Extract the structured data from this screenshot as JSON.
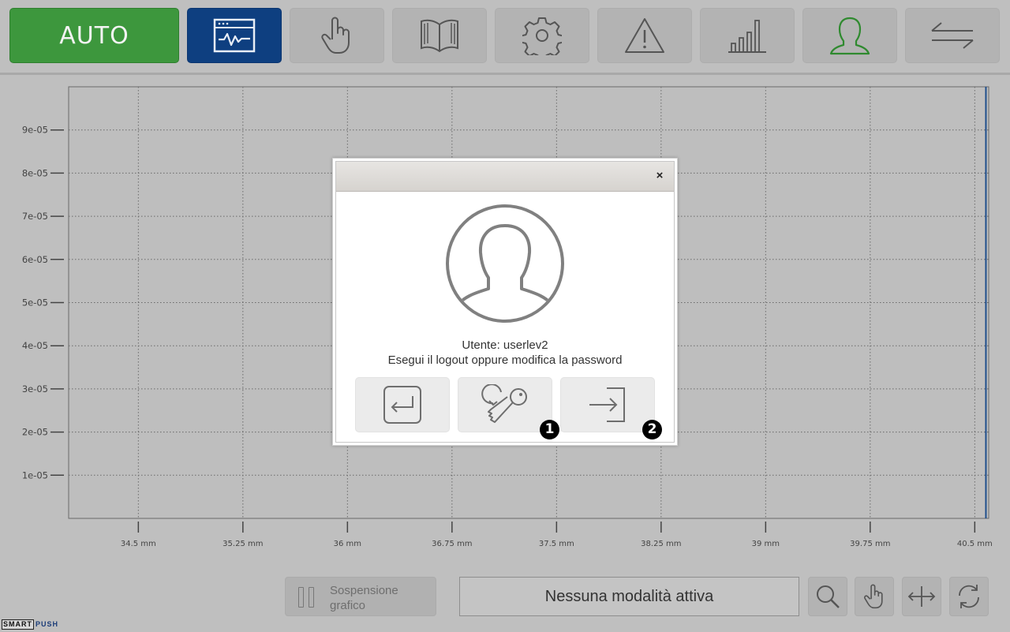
{
  "toolbar": {
    "auto_label": "AUTO",
    "accent_green": "#3d973d",
    "accent_blue": "#0e3f80",
    "items": [
      {
        "icon": "graph-window-icon",
        "active": true
      },
      {
        "icon": "hand-pointer-icon"
      },
      {
        "icon": "book-icon"
      },
      {
        "icon": "gear-icon"
      },
      {
        "icon": "warning-icon"
      },
      {
        "icon": "bar-chart-icon"
      },
      {
        "icon": "user-icon",
        "highlighted": true
      },
      {
        "icon": "swap-arrows-icon"
      }
    ]
  },
  "chart_data": {
    "type": "line",
    "x_tick_labels": [
      "34.5 mm",
      "35.25 mm",
      "36 mm",
      "36.75 mm",
      "37.5 mm",
      "38.25 mm",
      "39 mm",
      "39.75 mm",
      "40.5 mm"
    ],
    "x_ticks": [
      34.5,
      35.25,
      36,
      36.75,
      37.5,
      38.25,
      39,
      39.75,
      40.5
    ],
    "y_tick_labels": [
      "9e-05",
      "8e-05",
      "7e-05",
      "6e-05",
      "5e-05",
      "4e-05",
      "3e-05",
      "2e-05",
      "1e-05"
    ],
    "y_ticks": [
      9e-05,
      8e-05,
      7e-05,
      6e-05,
      5e-05,
      4e-05,
      3e-05,
      2e-05,
      1e-05
    ],
    "xlim": [
      34.0,
      40.6
    ],
    "ylim": [
      0,
      0.0001
    ],
    "grid": true,
    "series": [
      {
        "color": "#1f4e8c",
        "points": [
          [
            40.58,
            0
          ],
          [
            40.58,
            0.0001
          ]
        ]
      }
    ]
  },
  "bottom": {
    "pause_label": "Sospensione grafico",
    "mode_text": "Nessuna modalità attiva",
    "tools": [
      "zoom-icon",
      "pan-hand-icon",
      "horizontal-resize-icon",
      "refresh-icon"
    ]
  },
  "brand": {
    "smart": "SMART",
    "push": "PUSH"
  },
  "dialog": {
    "close_label": "×",
    "user_text": "Utente: userlev2",
    "hint_text": "Esegui il logout oppure modifica la password",
    "buttons": [
      {
        "icon": "back-enter-icon"
      },
      {
        "icon": "change-password-key-icon",
        "callout": "1"
      },
      {
        "icon": "logout-icon",
        "callout": "2"
      }
    ]
  }
}
